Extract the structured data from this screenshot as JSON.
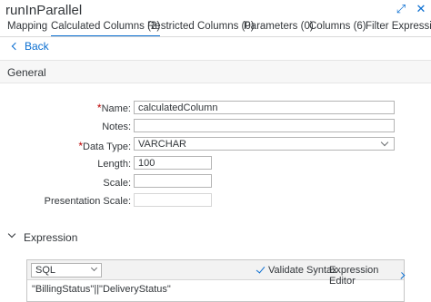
{
  "header": {
    "title": "runInParallel",
    "icons": [
      "expand-icon",
      "close-icon"
    ]
  },
  "tabs": [
    {
      "label": "Mapping",
      "selected": false
    },
    {
      "label": "Calculated Columns (2)",
      "selected": true
    },
    {
      "label": "Restricted Columns (0)",
      "selected": false
    },
    {
      "label": "Parameters (0)",
      "selected": false
    },
    {
      "label": "Columns (6)",
      "selected": false
    },
    {
      "label": "Filter Expression",
      "selected": false
    }
  ],
  "back": {
    "label": "Back"
  },
  "general": {
    "title": "General",
    "fields": {
      "name": {
        "label": "Name:",
        "value": "calculatedColumn",
        "required": true
      },
      "notes": {
        "label": "Notes:",
        "value": ""
      },
      "data_type": {
        "label": "Data Type:",
        "value": "VARCHAR",
        "required": true
      },
      "length": {
        "label": "Length:",
        "value": "100"
      },
      "scale": {
        "label": "Scale:",
        "value": ""
      },
      "presentation_scale": {
        "label": "Presentation Scale:",
        "value": ""
      }
    }
  },
  "expression": {
    "title": "Expression",
    "language": "SQL",
    "validate_label": "Validate Syntax",
    "editor_label": "Expression Editor",
    "code": "\"BillingStatus\"||\"DeliveryStatus\""
  },
  "colors": {
    "accent": "#0a6ed1",
    "required": "#bb0000"
  }
}
